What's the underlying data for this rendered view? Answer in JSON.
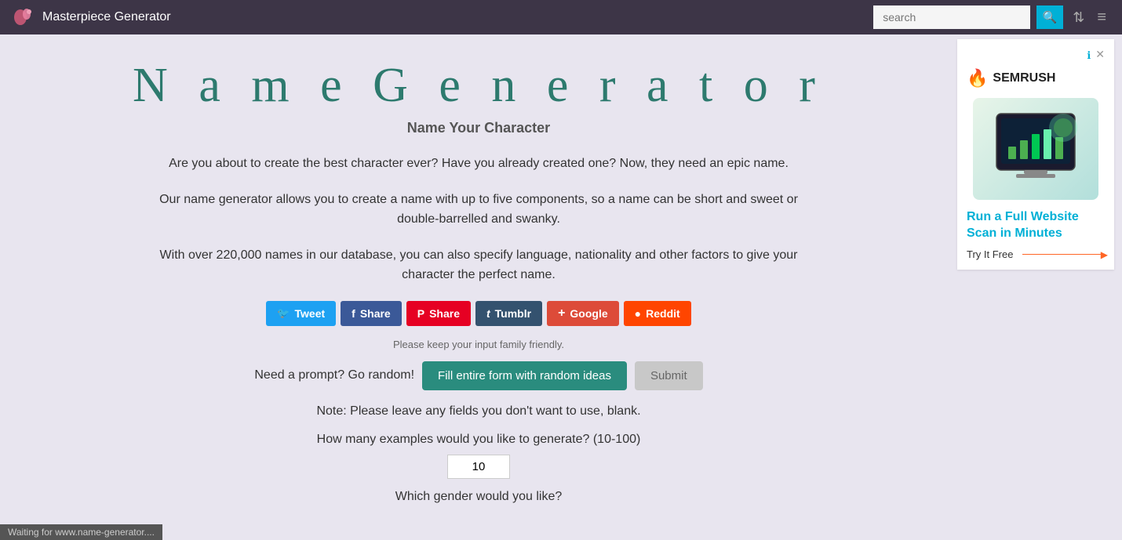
{
  "header": {
    "site_title": "Masterpiece Generator",
    "search_placeholder": "search",
    "search_button_label": "🔍"
  },
  "page": {
    "title": "N a m e   G e n e r a t o r",
    "subtitle": "Name Your Character",
    "desc1": "Are you about to create the best character ever? Have you already created one? Now, they need an epic name.",
    "desc2": "Our name generator allows you to create a name with up to five components, so a name can be short and sweet or double-barrelled and swanky.",
    "desc3": "With over 220,000 names in our database, you can also specify language, nationality and other factors to give your character the perfect name.",
    "family_notice": "Please keep your input family friendly.",
    "prompt_label": "Need a prompt? Go random!",
    "fill_random_label": "Fill entire form with random ideas",
    "submit_label": "Submit",
    "note_text": "Note: Please leave any fields you don't want to use, blank.",
    "examples_label": "How many examples would you like to generate? (10-100)",
    "examples_value": "10",
    "gender_question": "Which gender would you like?"
  },
  "social": [
    {
      "label": "Tweet",
      "class": "btn-twitter",
      "icon": "🐦"
    },
    {
      "label": "Share",
      "class": "btn-facebook",
      "icon": "f"
    },
    {
      "label": "Share",
      "class": "btn-pinterest",
      "icon": "P"
    },
    {
      "label": "Tumblr",
      "class": "btn-tumblr",
      "icon": "t"
    },
    {
      "label": "Google",
      "class": "btn-google",
      "icon": "+"
    },
    {
      "label": "Reddit",
      "class": "btn-reddit",
      "icon": "●"
    }
  ],
  "ad": {
    "brand": "SEMRUSH",
    "headline_part1": "Run a Full Website Scan ",
    "headline_accent": "in Minutes",
    "cta": "Try It Free"
  },
  "status": {
    "text": "Waiting for www.name-generator...."
  }
}
